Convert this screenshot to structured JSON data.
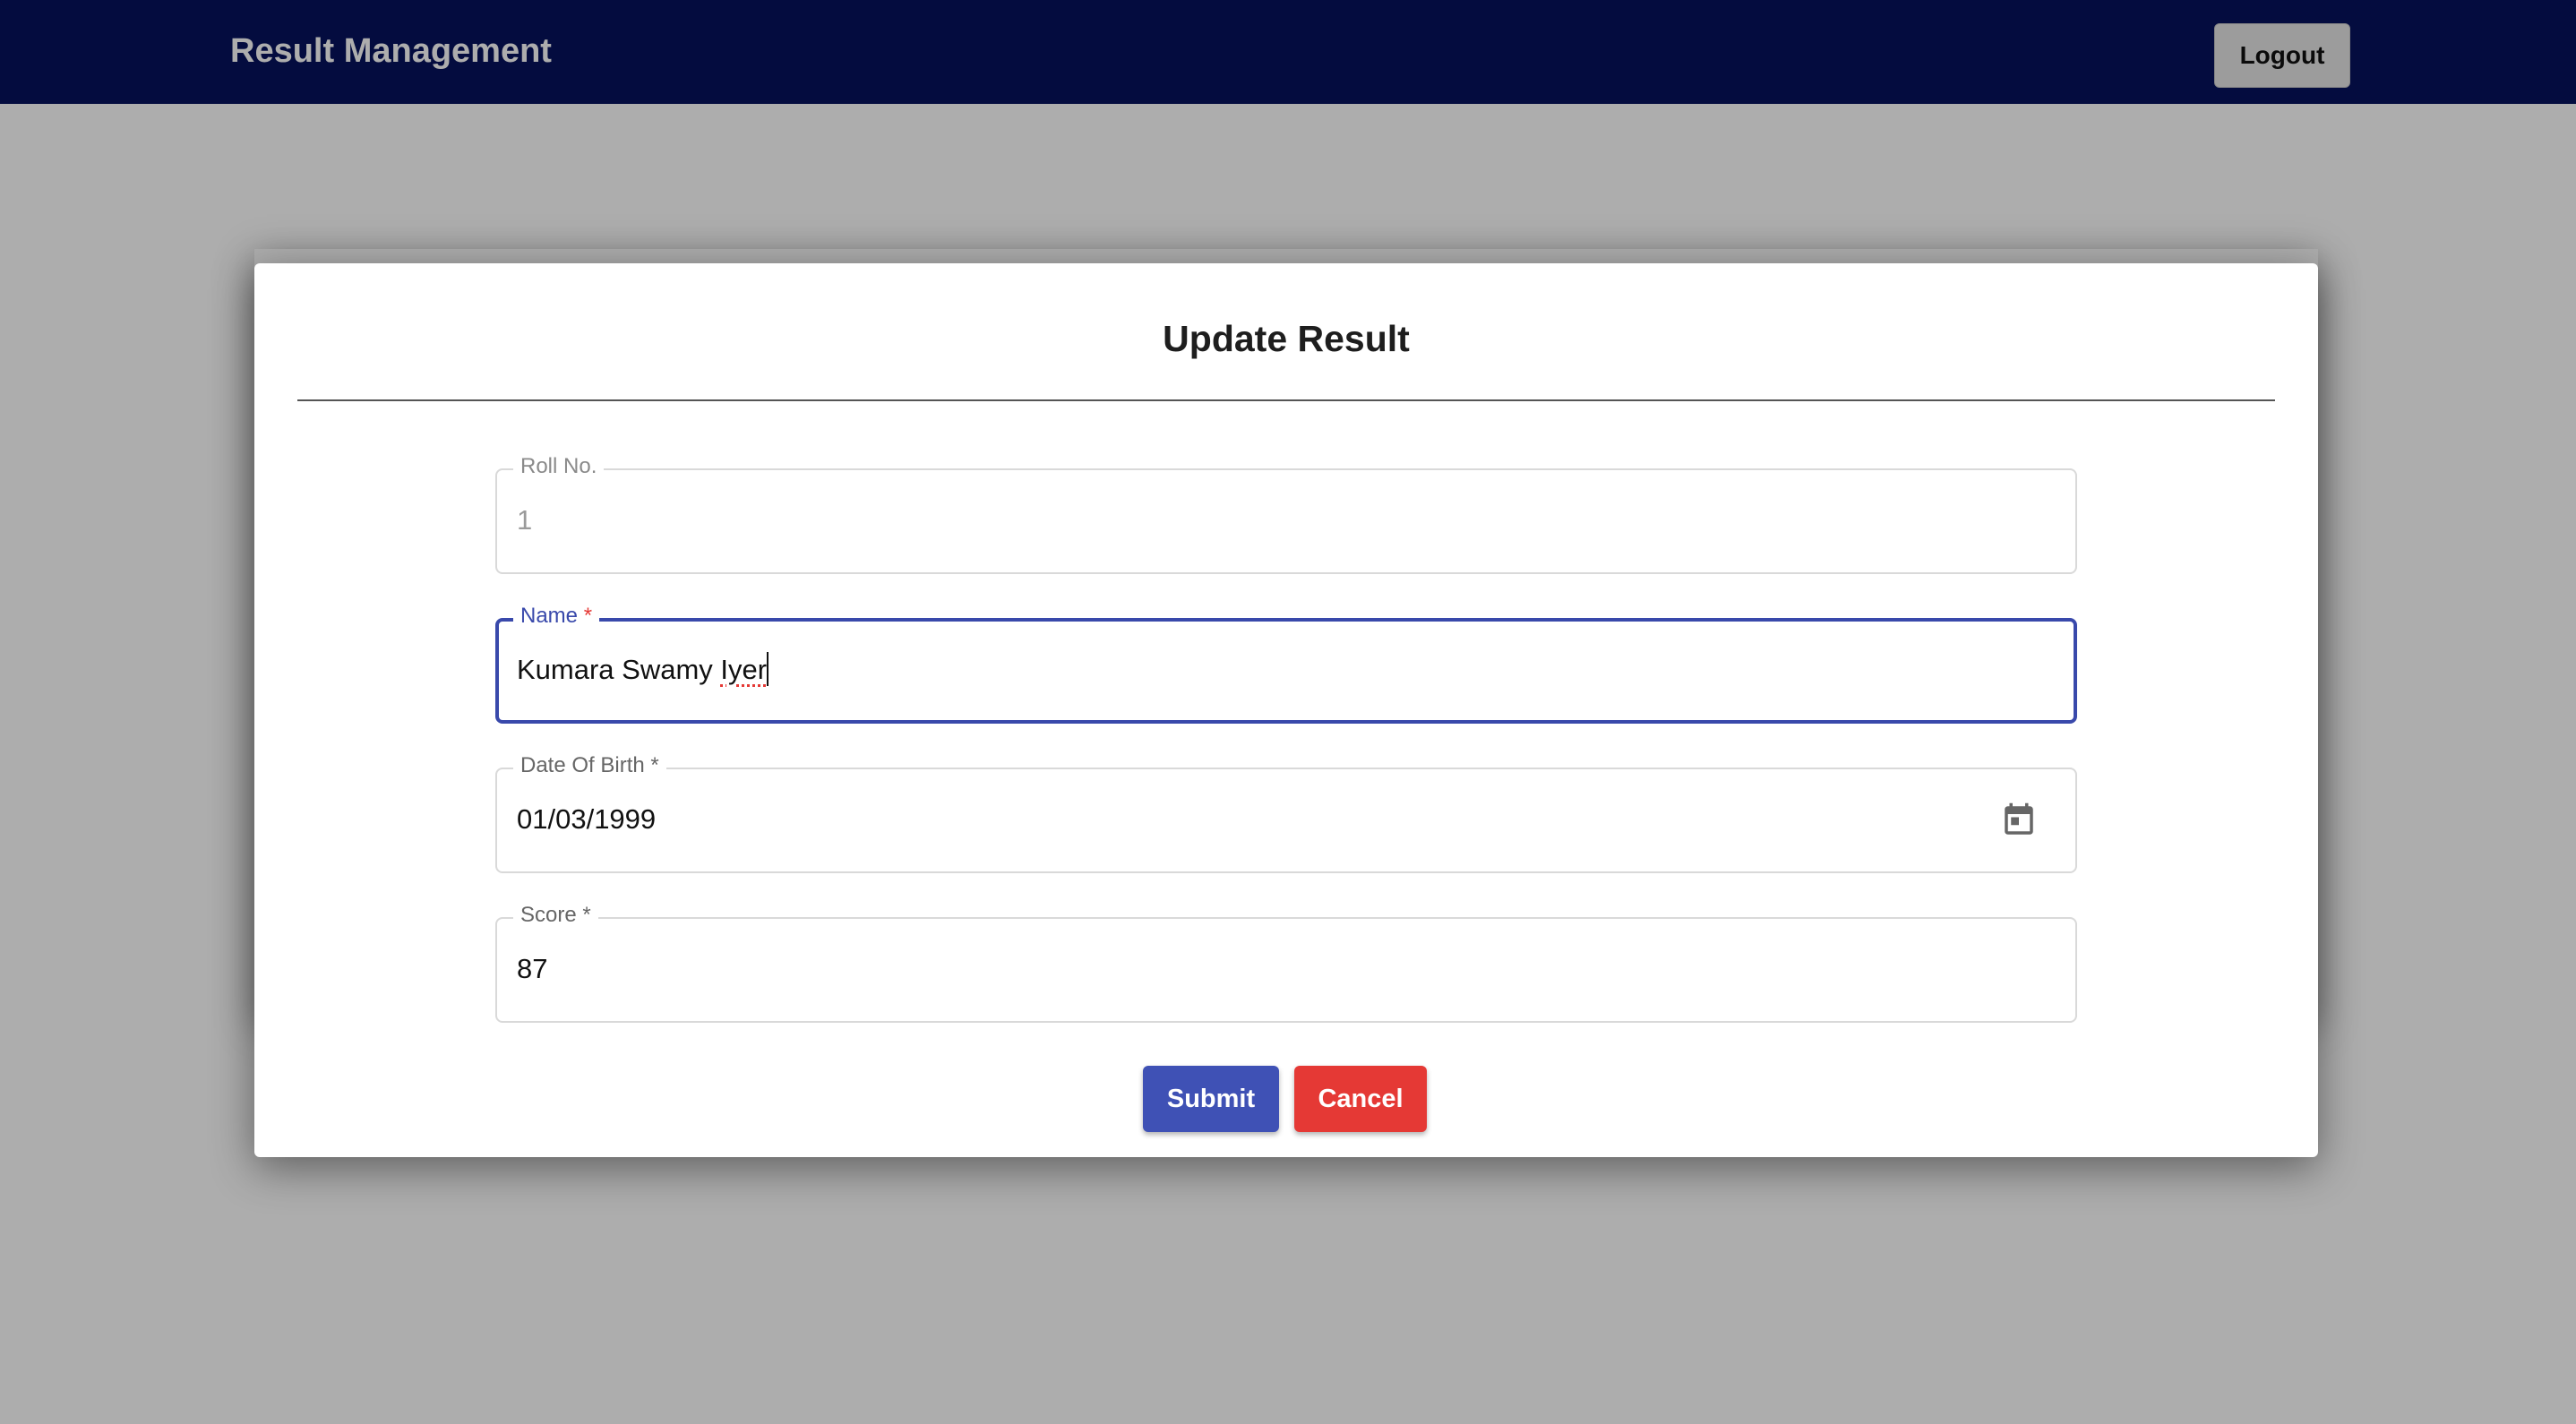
{
  "header": {
    "brand": "Result Management",
    "logout_label": "Logout"
  },
  "modal": {
    "title": "Update Result",
    "fields": {
      "roll_no": {
        "label": "Roll No.",
        "value": "1",
        "disabled": true
      },
      "name": {
        "label": "Name",
        "required_mark": "*",
        "value_prefix": "Kumara Swamy ",
        "value_flagged": "Iyer",
        "focused": true
      },
      "dob": {
        "label": "Date Of Birth",
        "required_mark": "*",
        "value": "01/03/1999",
        "icon": "calendar-icon"
      },
      "score": {
        "label": "Score",
        "required_mark": "*",
        "value": "87"
      }
    },
    "submit_label": "Submit",
    "cancel_label": "Cancel"
  },
  "colors": {
    "navbar": "#06135d",
    "primary": "#3f51b5",
    "danger": "#e53935",
    "overlay": "rgba(0,0,0,0.32)"
  }
}
